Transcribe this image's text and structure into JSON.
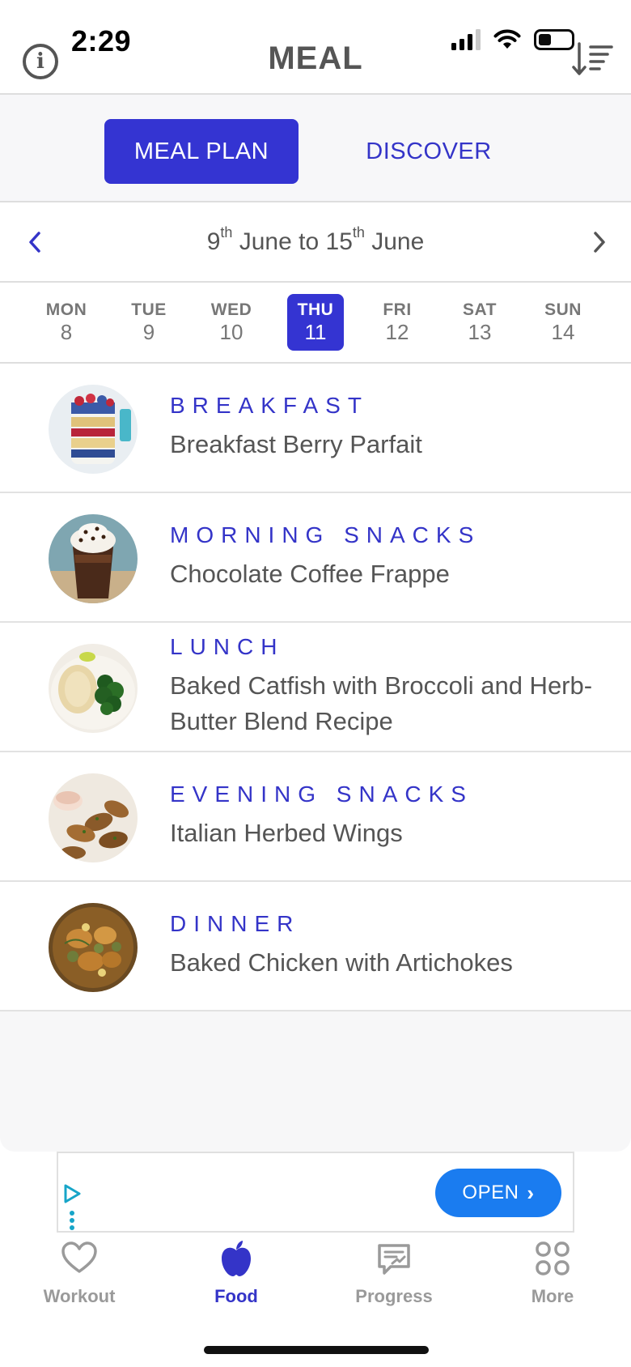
{
  "status_bar": {
    "time": "2:29"
  },
  "header": {
    "title": "MEAL"
  },
  "tabs": [
    {
      "label": "MEAL PLAN",
      "active": true
    },
    {
      "label": "DISCOVER",
      "active": false
    }
  ],
  "week": {
    "start_day": "9",
    "start_suffix": "th",
    "start_month": "June",
    "connector": "to",
    "end_day": "15",
    "end_suffix": "th",
    "end_month": "June"
  },
  "days": [
    {
      "dow": "MON",
      "dom": "8"
    },
    {
      "dow": "TUE",
      "dom": "9"
    },
    {
      "dow": "WED",
      "dom": "10"
    },
    {
      "dow": "THU",
      "dom": "11",
      "active": true
    },
    {
      "dow": "FRI",
      "dom": "12"
    },
    {
      "dow": "SAT",
      "dom": "13"
    },
    {
      "dow": "SUN",
      "dom": "14"
    }
  ],
  "meals": [
    {
      "label": "BREAKFAST",
      "name": "Breakfast Berry Parfait"
    },
    {
      "label": "MORNING SNACKS",
      "name": "Chocolate Coffee Frappe"
    },
    {
      "label": "LUNCH",
      "name": "Baked Catfish with Broccoli and Herb-Butter Blend Recipe"
    },
    {
      "label": "EVENING SNACKS",
      "name": "Italian Herbed Wings"
    },
    {
      "label": "DINNER",
      "name": "Baked Chicken with Artichokes"
    }
  ],
  "ad": {
    "open_label": "OPEN"
  },
  "bottom_nav": [
    {
      "label": "Workout",
      "icon": "heart-icon"
    },
    {
      "label": "Food",
      "icon": "apple-icon",
      "active": true
    },
    {
      "label": "Progress",
      "icon": "progress-icon"
    },
    {
      "label": "More",
      "icon": "grid-icon"
    }
  ],
  "colors": {
    "accent": "#3434d2",
    "ad_button": "#1a7cf0",
    "text": "#555555",
    "muted": "#9a9a9a"
  }
}
